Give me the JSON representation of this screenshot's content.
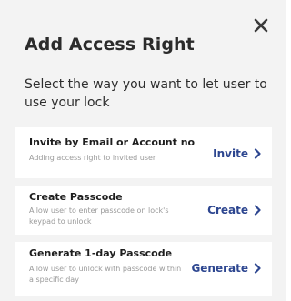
{
  "dialog": {
    "title": "Add Access Right",
    "subtitle": "Select the way you want to let user to use your lock",
    "close_icon": "close-icon"
  },
  "options": [
    {
      "title": "Invite by Email or Account no",
      "description": "Adding access right to invited user",
      "action_label": "Invite",
      "action_icon": "chevron-right-icon"
    },
    {
      "title": "Create Passcode",
      "description": "Allow user to enter passcode on lock's keypad to unlock",
      "action_label": "Create",
      "action_icon": "chevron-right-icon"
    },
    {
      "title": "Generate 1-day Passcode",
      "description": "Allow user to unlock with passcode within a specific day",
      "action_label": "Generate",
      "action_icon": "chevron-right-icon"
    }
  ],
  "colors": {
    "background": "#f3f3f3",
    "card": "#ffffff",
    "accent": "#2d4690",
    "title": "#2b2b2b",
    "muted": "#9a9a9a"
  }
}
